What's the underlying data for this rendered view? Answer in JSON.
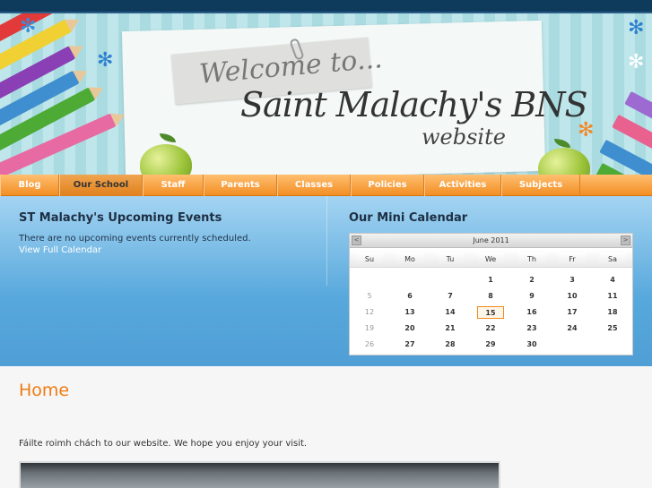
{
  "banner": {
    "welcome": "Welcome to...",
    "title": "Saint Malachy's BNS",
    "subtitle": "website"
  },
  "nav": [
    {
      "label": "Blog"
    },
    {
      "label": "Our School"
    },
    {
      "label": "Staff"
    },
    {
      "label": "Parents"
    },
    {
      "label": "Classes"
    },
    {
      "label": "Policies"
    },
    {
      "label": "Activities"
    },
    {
      "label": "Subjects"
    }
  ],
  "events": {
    "title": "ST Malachy's Upcoming Events",
    "message": "There are no upcoming events currently scheduled.",
    "link": "View Full Calendar"
  },
  "calendar": {
    "title": "Our Mini Calendar",
    "month": "June 2011",
    "prev": "<",
    "next": ">",
    "days_of_week": [
      "Su",
      "Mo",
      "Tu",
      "We",
      "Th",
      "Fr",
      "Sa"
    ],
    "weeks": [
      [
        "",
        "",
        "",
        "1",
        "2",
        "3",
        "4"
      ],
      [
        "5",
        "6",
        "7",
        "8",
        "9",
        "10",
        "11"
      ],
      [
        "12",
        "13",
        "14",
        "15",
        "16",
        "17",
        "18"
      ],
      [
        "19",
        "20",
        "21",
        "22",
        "23",
        "24",
        "25"
      ],
      [
        "26",
        "27",
        "28",
        "29",
        "30",
        "",
        ""
      ]
    ],
    "today": "15"
  },
  "content": {
    "title": "Home",
    "text": "Fáilte roimh chách to our website. We hope you enjoy your visit."
  },
  "colors": {
    "nav": "#f28f24",
    "accent": "#f07b12",
    "events_bg": "#57a8dc",
    "topbar": "#0e3a5c"
  }
}
